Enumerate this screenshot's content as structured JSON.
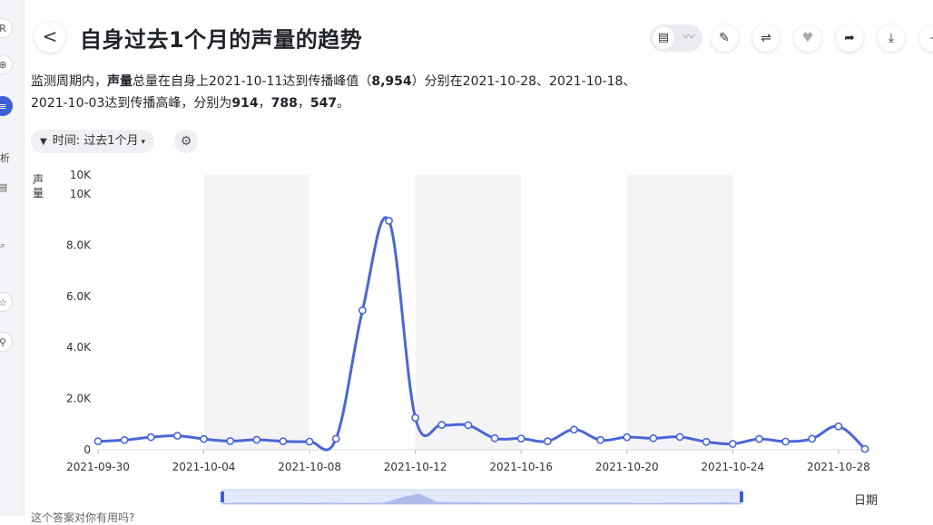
{
  "sidebar": {
    "items": [
      {
        "icon": "report-icon",
        "glyph": "R"
      },
      {
        "icon": "globe-icon",
        "glyph": "⊕"
      },
      {
        "icon": "analysis-icon",
        "glyph": "≡"
      },
      {
        "icon": "chart-icon",
        "glyph": "▤"
      },
      {
        "icon": "user-icon",
        "glyph": "⌕"
      },
      {
        "icon": "star-icon",
        "glyph": "☆"
      },
      {
        "icon": "search-icon",
        "glyph": "⚲"
      }
    ],
    "partial_text": "析"
  },
  "header": {
    "back_glyph": "<",
    "title": "自身过去1个月的声量的趋势"
  },
  "toolbar": {
    "view_table_glyph": "▤",
    "view_chart_glyph": "〰",
    "pin_glyph": "✎",
    "swap_glyph": "⇌",
    "favorite_glyph": "♥",
    "share_glyph": "➦",
    "download_glyph": "⤓",
    "more_glyph": "–"
  },
  "summary": {
    "part1": "监测周期内，",
    "bold1": "声量",
    "part2": "总量在自身上2021-10-11达到传播峰值（",
    "bold2": "8,954",
    "part3": "）分别在2021-10-28、2021-10-18、2021-10-03达到传播高峰，分别为",
    "bold3": "914",
    "sep1": "，",
    "bold4": "788",
    "sep2": "，",
    "bold5": "547",
    "end": "。"
  },
  "filter": {
    "label": "时间:",
    "value": "过去1个月"
  },
  "footer": {
    "text": "这个答案对你有用吗?"
  },
  "chart_data": {
    "type": "line",
    "ylabel": "声量",
    "xlabel": "日期",
    "y_ticks": [
      "0",
      "2.0K",
      "4.0K",
      "6.0K",
      "8.0K",
      "10K",
      "10K"
    ],
    "x_ticks": [
      "2021-09-30",
      "2021-10-04",
      "2021-10-08",
      "2021-10-12",
      "2021-10-16",
      "2021-10-20",
      "2021-10-24",
      "2021-10-28"
    ],
    "ylim": [
      0,
      10000
    ],
    "grid": false,
    "shaded_weeks": true,
    "line_color": "#4a66d8",
    "x": [
      "2021-09-30",
      "2021-10-01",
      "2021-10-02",
      "2021-10-03",
      "2021-10-04",
      "2021-10-05",
      "2021-10-06",
      "2021-10-07",
      "2021-10-08",
      "2021-10-09",
      "2021-10-10",
      "2021-10-11",
      "2021-10-12",
      "2021-10-13",
      "2021-10-14",
      "2021-10-15",
      "2021-10-16",
      "2021-10-17",
      "2021-10-18",
      "2021-10-19",
      "2021-10-20",
      "2021-10-21",
      "2021-10-22",
      "2021-10-23",
      "2021-10-24",
      "2021-10-25",
      "2021-10-26",
      "2021-10-27",
      "2021-10-28",
      "2021-10-29"
    ],
    "series": [
      {
        "values": [
          330,
          380,
          490,
          547,
          420,
          340,
          390,
          330,
          320,
          430,
          5450,
          8954,
          1250,
          970,
          960,
          450,
          440,
          330,
          788,
          380,
          490,
          450,
          500,
          310,
          230,
          420,
          320,
          430,
          914,
          30
        ]
      }
    ]
  }
}
